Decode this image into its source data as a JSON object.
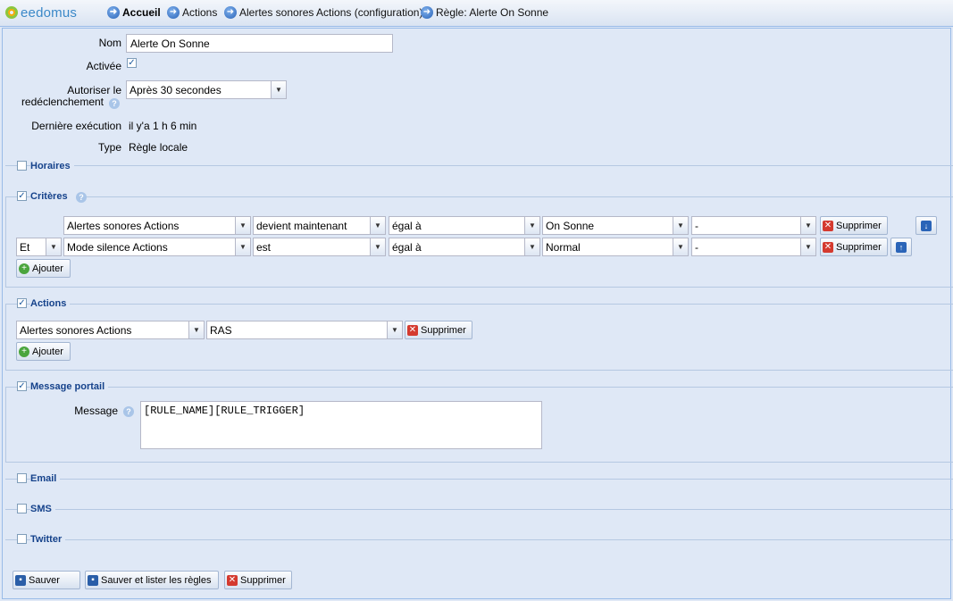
{
  "header": {
    "logo_text": "eedomus",
    "breadcrumb": [
      "Accueil",
      "Actions",
      "Alertes sonores Actions (configuration)",
      "Règle: Alerte On Sonne"
    ]
  },
  "form": {
    "nom_label": "Nom",
    "nom_value": "Alerte On Sonne",
    "activee_label": "Activée",
    "activee_checked": true,
    "autoriser_label_1": "Autoriser le",
    "autoriser_label_2": "redéclenchement",
    "autoriser_value": "Après 30 secondes",
    "derniere_label": "Dernière exécution",
    "derniere_value": "il y'a 1 h 6 min",
    "type_label": "Type",
    "type_value": "Règle locale"
  },
  "sections": {
    "horaires": "Horaires",
    "criteres": "Critères",
    "actions": "Actions",
    "message_portail": "Message portail",
    "email": "Email",
    "sms": "SMS",
    "twitter": "Twitter"
  },
  "criteres": {
    "rows": [
      {
        "connector": "",
        "device": "Alertes sonores Actions",
        "condition": "devient maintenant",
        "operator": "égal à",
        "value": "On Sonne",
        "extra": "-"
      },
      {
        "connector": "Et",
        "device": "Mode silence Actions",
        "condition": "est",
        "operator": "égal à",
        "value": "Normal",
        "extra": "-"
      }
    ],
    "delete_label": "Supprimer",
    "add_label": "Ajouter"
  },
  "actions": {
    "device": "Alertes sonores Actions",
    "value": "RAS",
    "delete_label": "Supprimer",
    "add_label": "Ajouter"
  },
  "message": {
    "label": "Message",
    "value": "[RULE_NAME][RULE_TRIGGER]"
  },
  "footer": {
    "save": "Sauver",
    "save_list": "Sauver et lister les règles",
    "delete": "Supprimer"
  },
  "colors": {
    "background": "#dfe8f6",
    "title_blue": "#15428b",
    "border": "#99bbe8"
  }
}
